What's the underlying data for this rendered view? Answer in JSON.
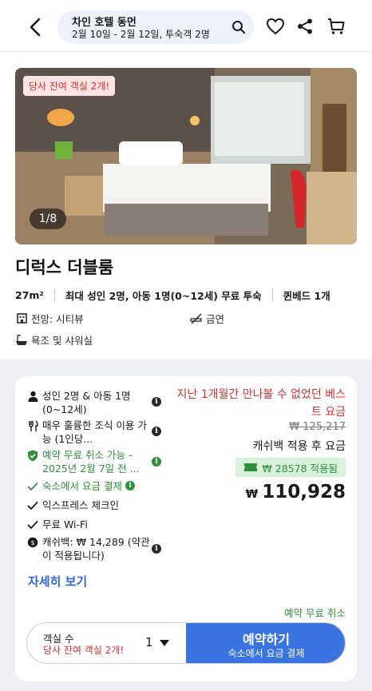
{
  "header": {
    "hotel_name": "차인 호텔 동먼",
    "search_summary": "2월 10일 - 2월 12일, 투숙객 2명"
  },
  "room": {
    "availability_badge": "당사 잔여 객실 2개!",
    "photo_counter": "1/8",
    "title": "디럭스 더블룸",
    "size": "27m²",
    "occupancy": "최대 성인 2명, 아동 1명(0~12세) 무료 투숙",
    "bed": "퀸베드 1개",
    "amenities": {
      "view": "전망: 시티뷰",
      "smoking": "금연",
      "bath": "욕조 및 샤워실"
    }
  },
  "offer": {
    "features": [
      {
        "text": "성인 2명 & 아동 1명 (0~12세)",
        "icon": "guest-icon"
      },
      {
        "text": "매우 훌륭한 조식 이용 가능 (1인당...",
        "icon": "utensils-icon"
      },
      {
        "text": "예약 무료 취소 가능 - 2025년 2월 7일 전 ...",
        "icon": "shield-check-icon"
      },
      {
        "text": "숙소에서 요금 결제",
        "icon": "check-icon"
      },
      {
        "text": "익스프레스 체크인",
        "icon": "check-icon"
      },
      {
        "text": "무료 Wi-Fi",
        "icon": "check-icon"
      },
      {
        "text": "캐쉬백: ₩ 14,289 (약관이 적용됩니다)",
        "icon": "cashback-icon"
      }
    ],
    "promo_text": "지난 1개월간 만나볼 수 없었던 베스트 요금",
    "original_price": "₩ 125,217",
    "after_cashback_label": "캐쉬백 적용 후 요금",
    "cashback_applied": "₩ 28578 적용됨",
    "currency": "₩",
    "price": "110,928",
    "details_link": "자세히 보기",
    "free_cancel": "예약 무료 취소",
    "rooms_label": "객실 수",
    "rooms_remaining": "당사 잔여 객실 2개!",
    "rooms_qty": "1",
    "book_label": "예약하기",
    "book_sublabel": "숙소에서 요금 결제"
  },
  "colors": {
    "primary_blue": "#3a74e0",
    "sale_red": "#d8302e",
    "success_green": "#2f8f3d",
    "cashback_bg": "#d8f1d9"
  }
}
